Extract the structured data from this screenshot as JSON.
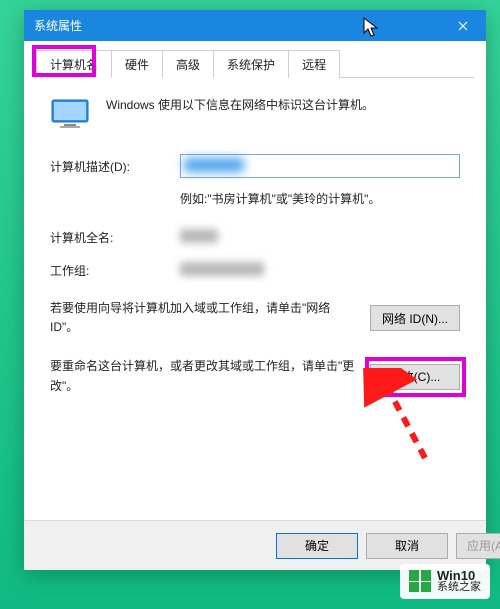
{
  "titlebar": {
    "title": "系统属性"
  },
  "tabs": [
    {
      "label": "计算机名",
      "active": true
    },
    {
      "label": "硬件"
    },
    {
      "label": "高级"
    },
    {
      "label": "系统保护"
    },
    {
      "label": "远程"
    }
  ],
  "info_text": "Windows 使用以下信息在网络中标识这台计算机。",
  "description": {
    "label": "计算机描述(D):",
    "value": "",
    "example": "例如:\"书房计算机\"或\"美玲的计算机\"。"
  },
  "fullname": {
    "label": "计算机全名:",
    "value": ""
  },
  "workgroup": {
    "label": "工作组:",
    "value": ""
  },
  "network_id": {
    "text": "若要使用向导将计算机加入域或工作组，请单击\"网络 ID\"。",
    "button": "网络 ID(N)..."
  },
  "change": {
    "text": "要重命名这台计算机，或者更改其域或工作组，请单击\"更改\"。",
    "button": "更改(C)..."
  },
  "footer": {
    "ok": "确定",
    "cancel": "取消",
    "apply": "应用(A)"
  },
  "watermark": {
    "line1": "Win10",
    "line2": "系统之家"
  }
}
